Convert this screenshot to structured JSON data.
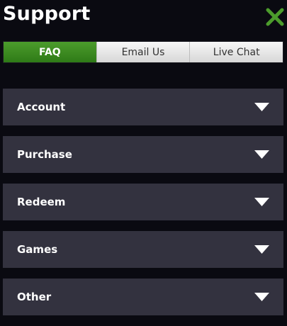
{
  "header": {
    "title": "Support",
    "close_icon": "close-x-icon",
    "close_color": "#4c9c2c"
  },
  "tabs": [
    {
      "label": "FAQ",
      "active": true
    },
    {
      "label": "Email Us",
      "active": false
    },
    {
      "label": "Live Chat",
      "active": false
    }
  ],
  "faq": {
    "items": [
      {
        "label": "Account",
        "icon": "chevron-down-icon"
      },
      {
        "label": "Purchase",
        "icon": "chevron-down-icon"
      },
      {
        "label": "Redeem",
        "icon": "chevron-down-icon"
      },
      {
        "label": "Games",
        "icon": "chevron-down-icon"
      },
      {
        "label": "Other",
        "icon": "chevron-down-icon"
      }
    ]
  },
  "colors": {
    "background": "#0a0a11",
    "accent": "#4c9c2c",
    "item_background": "#33323f"
  }
}
